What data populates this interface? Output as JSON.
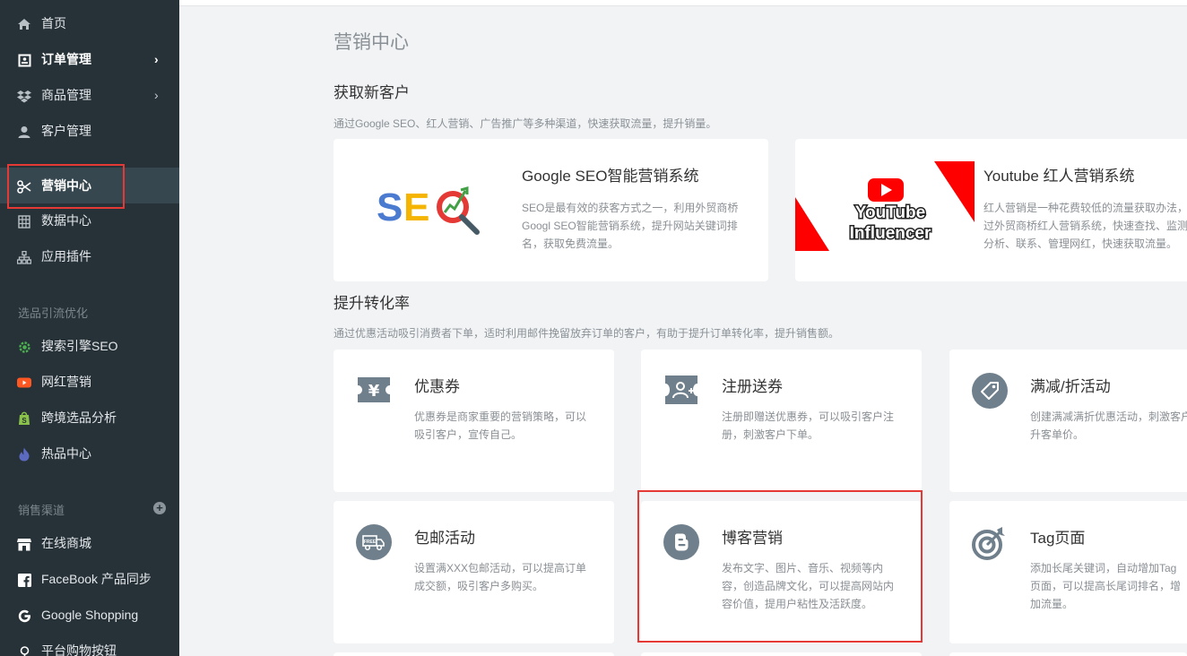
{
  "sidebar": {
    "items": [
      {
        "label": "首页",
        "icon": "home-icon"
      },
      {
        "label": "订单管理",
        "icon": "order-icon",
        "chevron": "›"
      },
      {
        "label": "商品管理",
        "icon": "dropbox-icon",
        "chevron": "›"
      },
      {
        "label": "客户管理",
        "icon": "user-icon"
      },
      {
        "label": "营销中心",
        "icon": "marketing-icon"
      },
      {
        "label": "数据中心",
        "icon": "data-icon"
      },
      {
        "label": "应用插件",
        "icon": "plugin-icon"
      }
    ],
    "section1": "选品引流优化",
    "items2": [
      {
        "label": "搜索引擎SEO",
        "icon": "seo-gear-icon",
        "color": "#4caf50"
      },
      {
        "label": "网红营销",
        "icon": "youtube-icon",
        "color": "#ff5722"
      },
      {
        "label": "跨境选品分析",
        "icon": "shopify-icon",
        "color": "#8bc34a"
      },
      {
        "label": "热品中心",
        "icon": "fire-icon",
        "color": "#3f51b5"
      }
    ],
    "section2": "销售渠道",
    "section2_add": "+",
    "items3": [
      {
        "label": "在线商城",
        "icon": "store-icon"
      },
      {
        "label": "FaceBook 产品同步",
        "icon": "facebook-icon"
      },
      {
        "label": "Google Shopping",
        "icon": "google-icon"
      },
      {
        "label": "平台购物按钮",
        "icon": "cart-button-icon"
      }
    ]
  },
  "main": {
    "page_title": "营销中心",
    "acquire": {
      "title": "获取新客户",
      "desc": "通过Google SEO、红人营销、广告推广等多种渠道，快速获取流量，提升销量。",
      "cards": [
        {
          "title": "Google SEO智能营销系统",
          "desc": "SEO是最有效的获客方式之一，利用外贸商桥Googl SEO智能营销系统，提升网站关键词排名，获取免费流量。",
          "logo_text": "SEO"
        },
        {
          "title": "Youtube 红人营销系统",
          "desc": "红人营销是一种花费较低的流量获取办法，通过外贸商桥红人营销系统，快速查找、监测、分析、联系、管理网红，快速获取流量。",
          "logo_line1": "YouTube",
          "logo_line2": "Influencer"
        }
      ]
    },
    "convert": {
      "title": "提升转化率",
      "desc": "通过优惠活动吸引消费者下单，适时利用邮件挽留放弃订单的客户，有助于提升订单转化率，提升销售额。",
      "cards": [
        {
          "title": "优惠券",
          "desc": "优惠券是商家重要的营销策略，可以吸引客户，宣传自己。",
          "icon": "coupon-icon"
        },
        {
          "title": "注册送券",
          "desc": "注册即赠送优惠券，可以吸引客户注册，刺激客户下单。",
          "icon": "register-coupon-icon"
        },
        {
          "title": "满减/折活动",
          "desc": "创建满减满折优惠活动，刺激客户提升客单价。",
          "icon": "tag-discount-icon"
        },
        {
          "title": "包邮活动",
          "desc": "设置满XXX包邮活动，可以提高订单成交额，吸引客户多购买。",
          "icon": "free-shipping-icon",
          "icon_text": "FREE"
        },
        {
          "title": "博客营销",
          "desc": "发布文字、图片、音乐、视频等内容，创造品牌文化，可以提高网站内容价值，提用户粘性及活跃度。",
          "icon": "blog-icon"
        },
        {
          "title": "Tag页面",
          "desc": "添加长尾关键词，自动增加Tag页面，可以提高长尾词排名，增加流量。",
          "icon": "target-icon"
        }
      ]
    }
  }
}
